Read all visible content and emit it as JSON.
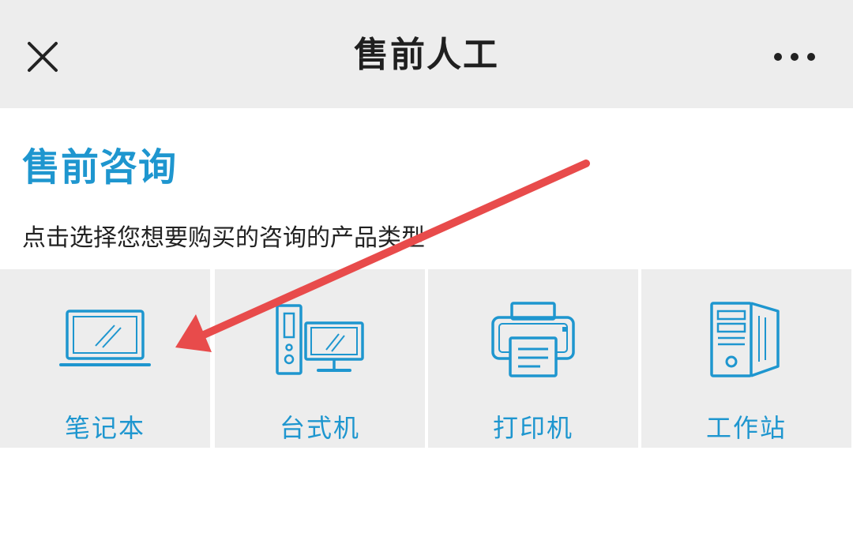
{
  "header": {
    "title": "售前人工",
    "close_icon": "close-icon",
    "more_icon": "more-horizontal-icon"
  },
  "section": {
    "title": "售前咨询",
    "subtitle": "点击选择您想要购买的咨询的产品类型"
  },
  "products": [
    {
      "label": "笔记本",
      "icon": "laptop-icon"
    },
    {
      "label": "台式机",
      "icon": "desktop-computer-icon"
    },
    {
      "label": "打印机",
      "icon": "printer-icon"
    },
    {
      "label": "工作站",
      "icon": "workstation-icon"
    }
  ],
  "colors": {
    "accent": "#1e96cf",
    "header_bg": "#ededed",
    "tile_bg": "#ededed",
    "annotation_arrow": "#e84b4b"
  }
}
